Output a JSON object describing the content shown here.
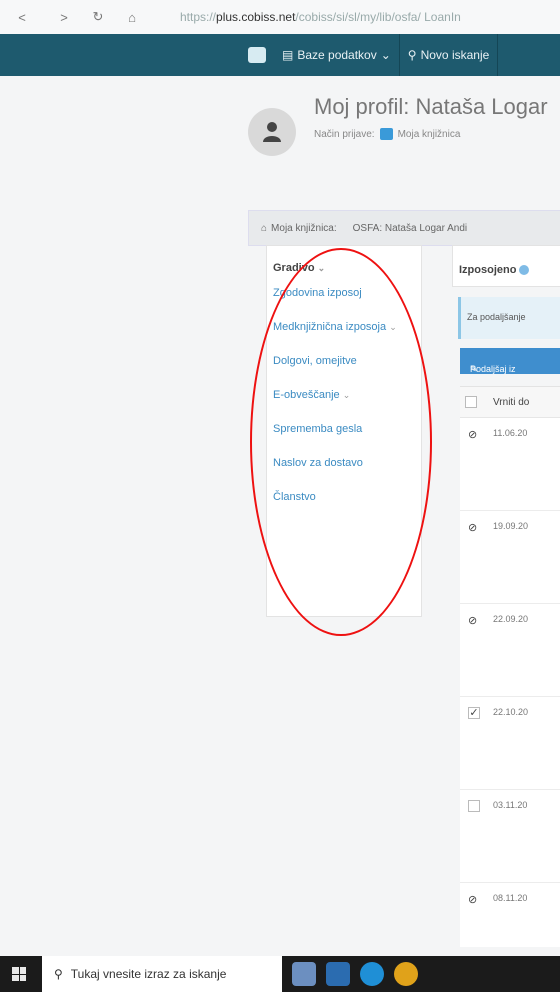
{
  "browser": {
    "url_prefix": "https://",
    "url_host": "plus.cobiss.net",
    "url_path": "/cobiss/si/sl/my/lib/osfa/ LoanIn"
  },
  "topnav": {
    "databases": "Baze podatkov",
    "search": "Novo iskanje"
  },
  "profile": {
    "title": "Moj profil: Nataša Logar",
    "login_label": "Način prijave:",
    "login_value": "Moja knjižnica"
  },
  "breadcrumb": {
    "home": "Moja knjižnica:",
    "library": "OSFA: Nataša Logar Andi"
  },
  "sidebar": {
    "heading": "Gradivo",
    "items": [
      {
        "label": "Zgodovina izposoj"
      },
      {
        "label": "Medknjižnična izposoja"
      },
      {
        "label": "Dolgovi, omejitve"
      },
      {
        "label": "E-obveščanje"
      },
      {
        "label": "Sprememba gesla"
      },
      {
        "label": "Naslov za dostavo"
      },
      {
        "label": "Članstvo"
      }
    ]
  },
  "tabs": {
    "loaned": "Izposojeno"
  },
  "info": {
    "text": "Za podaljšanje"
  },
  "share_button": "Podaljšaj iz",
  "table": {
    "col_return": "Vrniti do",
    "rows": [
      {
        "date": "11.06.20"
      },
      {
        "date": "19.09.20"
      },
      {
        "date": "22.09.20"
      },
      {
        "date": "22.10.20"
      },
      {
        "date": "03.11.20"
      },
      {
        "date": "08.11.20"
      }
    ]
  },
  "taskbar": {
    "search_placeholder": "Tukaj vnesite izraz za iskanje"
  },
  "colors": {
    "nav": "#1e5a6e",
    "link": "#3b8bc2",
    "button": "#3f8ece",
    "annotation": "#e11111"
  }
}
